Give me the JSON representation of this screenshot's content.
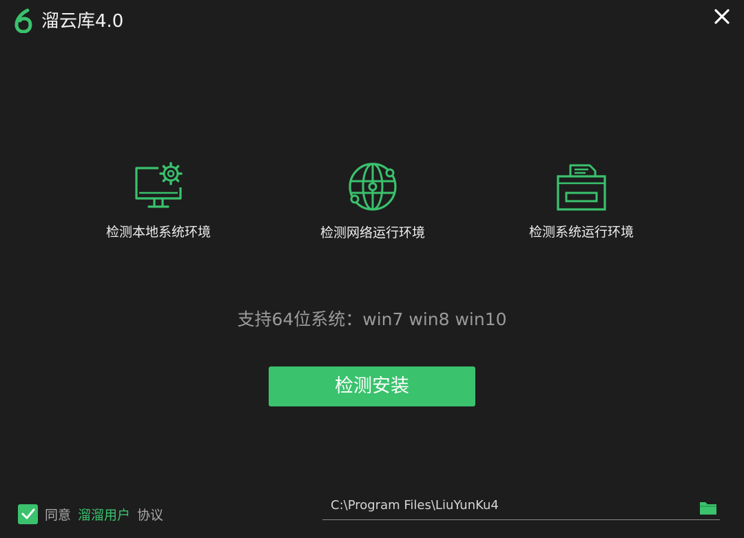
{
  "window": {
    "title": "溜云库4.0"
  },
  "features": [
    {
      "label": "检测本地系统环境",
      "icon": "monitor-gear-icon"
    },
    {
      "label": "检测网络运行环境",
      "icon": "globe-network-icon"
    },
    {
      "label": "检测系统运行环境",
      "icon": "printer-system-icon"
    }
  ],
  "support_text": "支持64位系统：win7 win8 win10",
  "install_button": {
    "label": "检测安装"
  },
  "agreement": {
    "checked": true,
    "prefix": "同意",
    "link": "溜溜用户",
    "suffix": "协议"
  },
  "install_path": {
    "value": "C:\\Program Files\\LiuYunKu4"
  },
  "colors": {
    "accent": "#3ac26d",
    "background": "#1d1d1d",
    "muted_text": "#9a9a9a"
  }
}
